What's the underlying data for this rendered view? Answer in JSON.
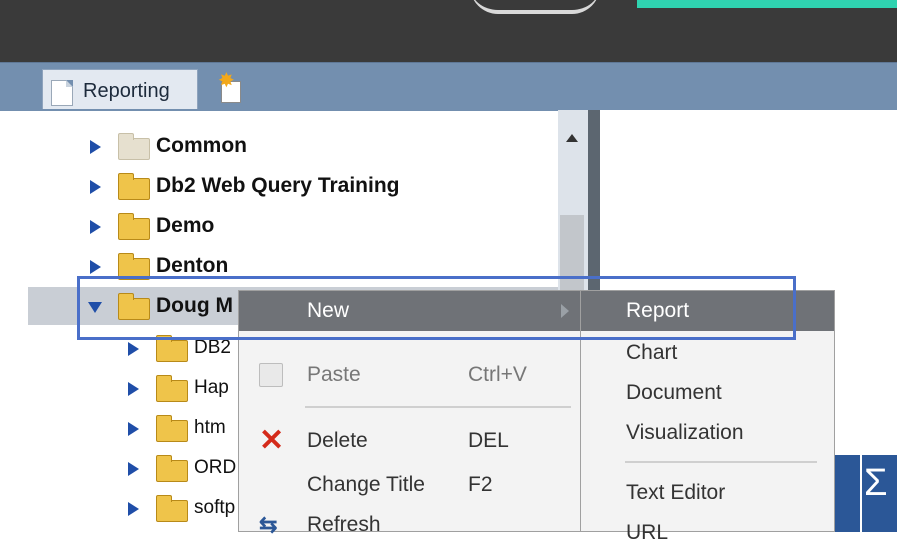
{
  "app": {
    "tabs": [
      {
        "label": "Reporting"
      }
    ]
  },
  "tree": {
    "items": [
      {
        "label": "Common",
        "folder": "grey",
        "expanded": false
      },
      {
        "label": "Db2 Web Query Training",
        "expanded": false
      },
      {
        "label": "Demo",
        "expanded": false
      },
      {
        "label": "Denton",
        "expanded": false
      },
      {
        "label": "Doug M",
        "expanded": true,
        "selected": true
      },
      {
        "label": "DB2"
      },
      {
        "label": "Hap"
      },
      {
        "label": "htm"
      },
      {
        "label": "ORD"
      },
      {
        "label": "softp"
      }
    ]
  },
  "context_menu": {
    "items": [
      {
        "label": "New",
        "shortcut": "",
        "highlighted": true,
        "submenu": true
      },
      {
        "label": "Paste",
        "shortcut": "Ctrl+V",
        "icon": "paste-icon"
      },
      {
        "label": "Delete",
        "shortcut": "DEL",
        "icon": "delete-icon"
      },
      {
        "label": "Change Title",
        "shortcut": "F2"
      },
      {
        "label": "Refresh",
        "shortcut": "",
        "icon": "refresh-icon"
      }
    ]
  },
  "submenu": {
    "items": [
      {
        "label": "Report",
        "highlighted": true
      },
      {
        "label": "Chart"
      },
      {
        "label": "Document"
      },
      {
        "label": "Visualization"
      },
      {
        "label": "Text Editor"
      },
      {
        "label": "URL"
      }
    ]
  },
  "toolbar_right": {
    "sigma": "Σ"
  },
  "colors": {
    "header_dark": "#3a3a3a",
    "tabbar": "#738faf",
    "tree_bg": "#dde3ea",
    "menu_highlight": "#6f7277",
    "callout": "#4a6fc9",
    "accent": "#2fd3b0"
  }
}
